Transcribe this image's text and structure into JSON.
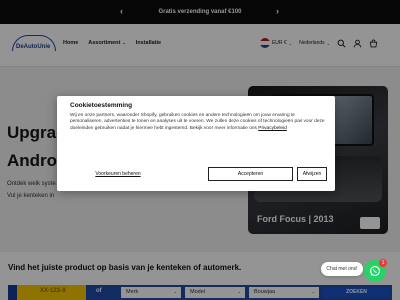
{
  "announcement": {
    "text": "Gratis verzending vanaf €100",
    "prev_icon": "chevron-left-icon",
    "next_icon": "chevron-right-icon"
  },
  "header": {
    "logo_text": "DeAutoUnie",
    "nav": [
      {
        "label": "Home"
      },
      {
        "label": "Assortiment",
        "has_dropdown": true
      },
      {
        "label": "Installatie"
      }
    ],
    "currency": "EUR €",
    "language": "Nederlands",
    "icons": [
      "search-icon",
      "account-icon",
      "cart-icon"
    ]
  },
  "hero": {
    "title_line1": "Upgrade",
    "title_line2": "Android A",
    "subtitle_line1": "Ontdek welk syste",
    "subtitle_line2": "Vul je kenteken in",
    "image_caption": "Ford Focus | 2013"
  },
  "finder": {
    "title": "Vind het juiste product op basis van je kenteken of automerk.",
    "plate_placeholder": "XX-123-X",
    "or_label": "of",
    "selects": [
      "Merk",
      "Model",
      "Bouwjaa"
    ],
    "submit_label": "ZOEKEN"
  },
  "cookie_modal": {
    "title": "Cookietoestemming",
    "body": "Wij en onze partners, waaronder Shopify, gebruiken cookies en andere technologieën om jouw ervaring te personaliseren, advertenties te tonen en analyses uit te voeren. We zullen deze cookies of technologieën pas voor deze doeleinden gebruiken nadat je hiermee hebt ingestemd. Bekijk voor meer informatie ons",
    "policy_link": "Privacybeleid",
    "buttons": {
      "manage": "Voorkeuren beheren",
      "accept": "Accepteren",
      "decline": "Afwijzen"
    }
  },
  "chat": {
    "label": "Chat met ons!",
    "badge_count": "1"
  },
  "colors": {
    "brand_blue": "#1f4aa8",
    "plate_yellow": "#f7c600",
    "whatsapp": "#25d366"
  }
}
